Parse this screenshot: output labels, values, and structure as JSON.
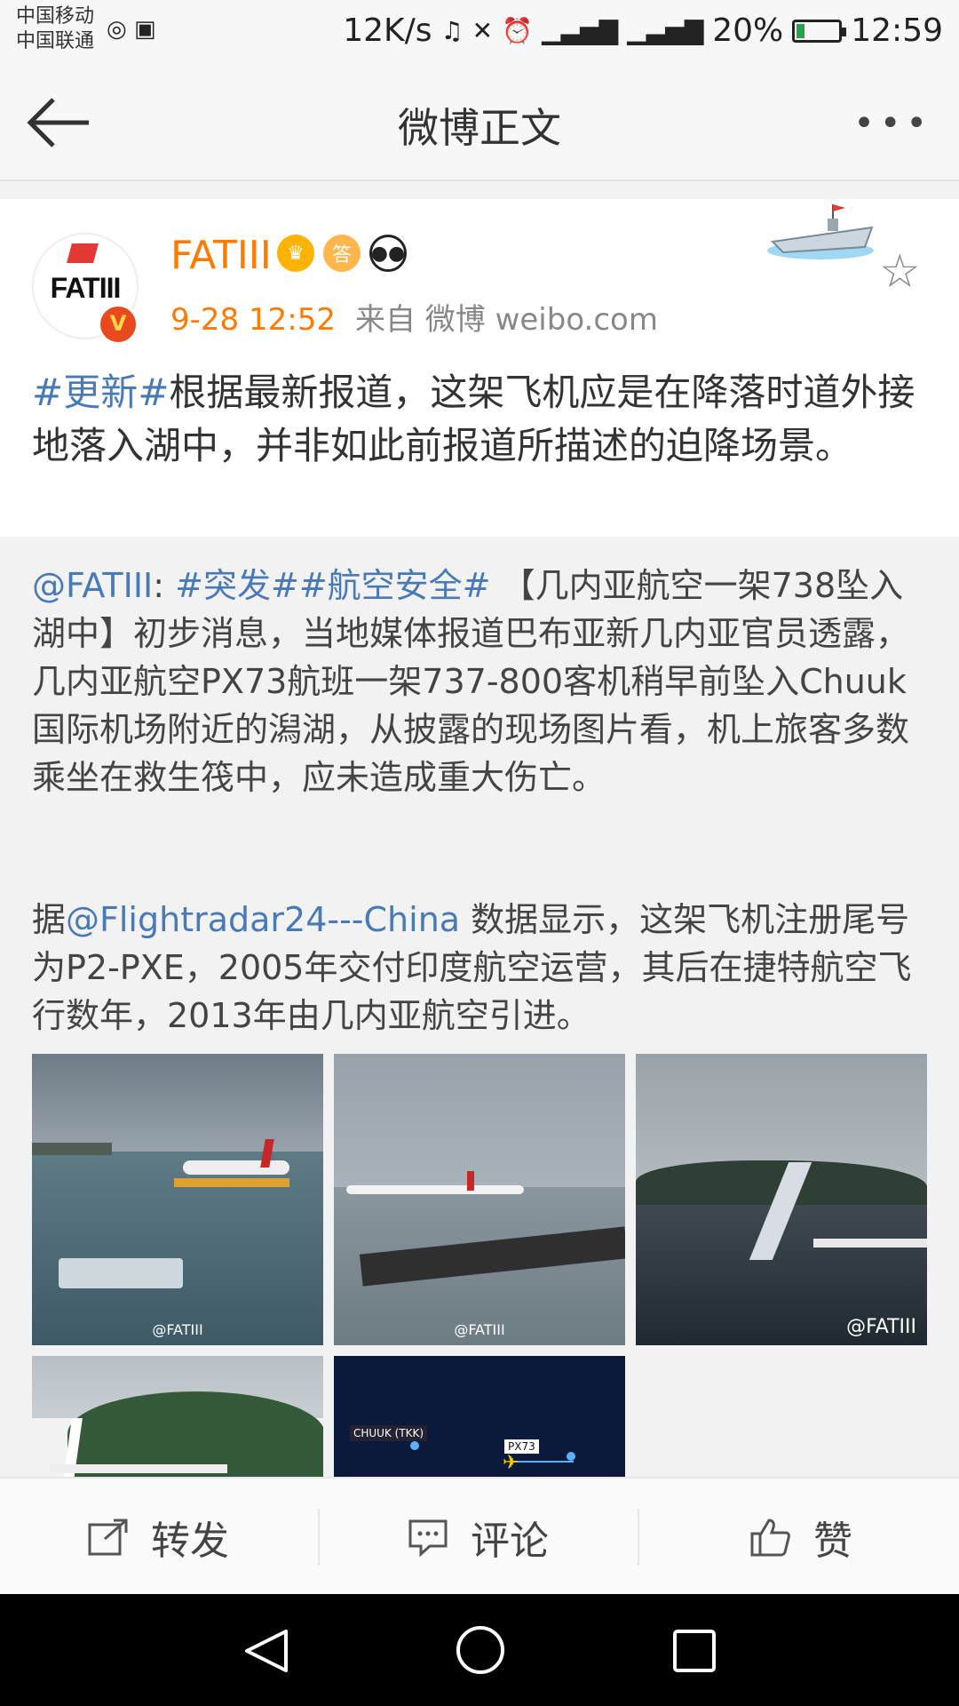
{
  "status_bar": {
    "carrier1": "中国移动",
    "carrier2": "中国联通",
    "speed": "12K/s",
    "battery": "20%",
    "time": "12:59",
    "battery_level": 0.2
  },
  "nav": {
    "title": "微博正文"
  },
  "post": {
    "username": "FATIII",
    "avatar_text": "FATIII",
    "time": "9-28 12:52",
    "source": "来自 微博 weibo.com",
    "topic": "#更新#",
    "text": "根据最新报道，这架飞机应是在降落时道外接地落入湖中，并非如此前报道所描述的迫降场景。"
  },
  "repost": {
    "mention": "@FATIII",
    "colon": ":",
    "topic1": "#突发#",
    "topic2": "#航空安全#",
    "text1": "【几内亚航空一架738坠入湖中】初步消息，当地媒体报道巴布亚新几内亚官员透露，几内亚航空PX73航班一架737-800客机稍早前坠入Chuuk国际机场附近的潟湖，从披露的现场图片看，机上旅客多数乘坐在救生筏中，应未造成重大伤亡。",
    "prefix2": "据",
    "mention2": "@Flightradar24---China",
    "text2": " 数据显示，这架飞机注册尾号为P2-PXE，2005年交付印度航空运营，其后在捷特航空飞行数年，2013年由几内亚航空引进。",
    "watermark": "@FATIII",
    "map_label1": "CHUUK (TKK)",
    "map_label2": "PX73"
  },
  "actions": {
    "repost": "转发",
    "comment": "评论",
    "like": "赞"
  },
  "colors": {
    "accent": "#ff7a00",
    "link": "#4a7ab5"
  }
}
